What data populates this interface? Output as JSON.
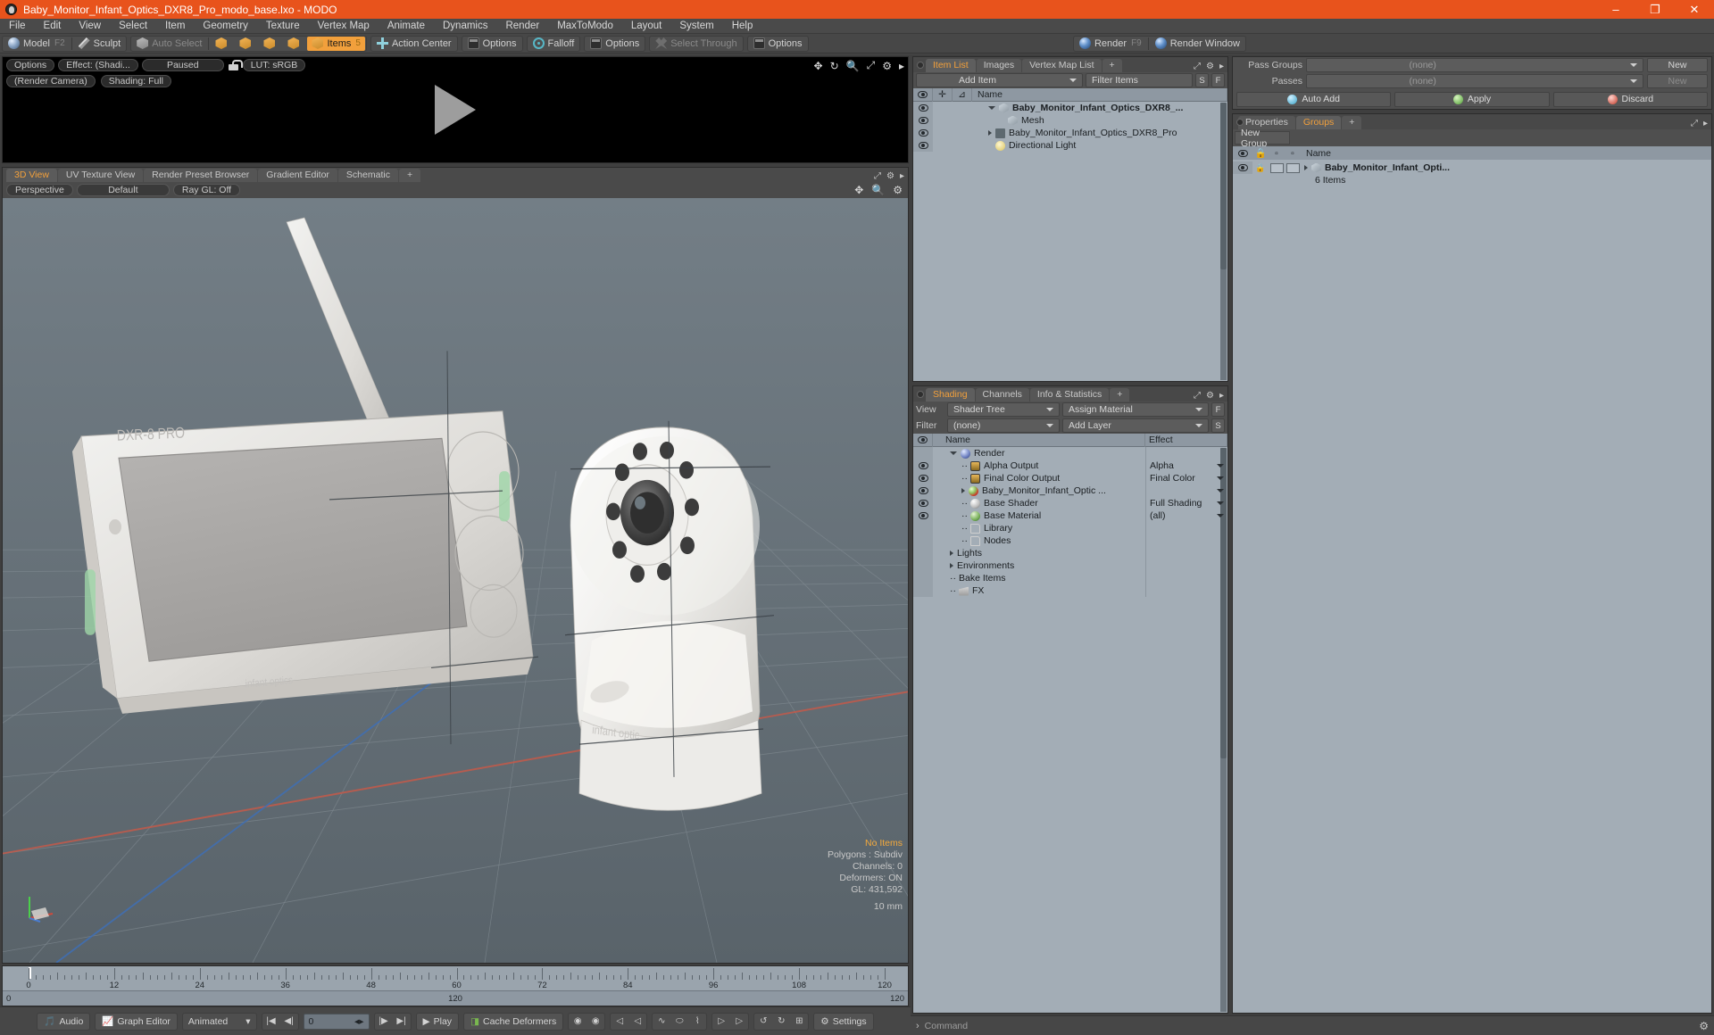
{
  "titlebar": {
    "title": "Baby_Monitor_Infant_Optics_DXR8_Pro_modo_base.lxo - MODO",
    "minimize": "–",
    "maximize": "❐",
    "close": "✕"
  },
  "menubar": {
    "items": [
      "File",
      "Edit",
      "View",
      "Select",
      "Item",
      "Geometry",
      "Texture",
      "Vertex Map",
      "Animate",
      "Dynamics",
      "Render",
      "MaxToModo",
      "Layout",
      "System",
      "Help"
    ]
  },
  "toolbar": {
    "model": "Model",
    "model_key": "F2",
    "sculpt": "Sculpt",
    "auto_select": "Auto Select",
    "items": "Items",
    "items_key": "5",
    "action_center": "Action Center",
    "options1": "Options",
    "falloff": "Falloff",
    "options2": "Options",
    "select_through": "Select Through",
    "options3": "Options",
    "render": "Render",
    "render_key": "F9",
    "render_window": "Render Window"
  },
  "preview": {
    "options": "Options",
    "effect": "Effect: (Shadi...",
    "paused": "Paused",
    "lut": "LUT: sRGB",
    "render_camera": "(Render Camera)",
    "shading": "Shading: Full"
  },
  "viewport": {
    "tabs": [
      "3D View",
      "UV Texture View",
      "Render Preset Browser",
      "Gradient Editor",
      "Schematic",
      "+"
    ],
    "active_tab": "3D View",
    "perspective": "Perspective",
    "default": "Default",
    "raygl": "Ray GL: Off",
    "overlay": {
      "no_items": "No Items",
      "polygons": "Polygons : Subdiv",
      "channels": "Channels: 0",
      "deformers": "Deformers: ON",
      "gl": "GL: 431,592",
      "scale": "10 mm"
    },
    "model_label_screen": "DXR-8 PRO",
    "model_label_brand": "infant optics"
  },
  "timeline": {
    "ticks": [
      "0",
      "12",
      "24",
      "36",
      "48",
      "60",
      "72",
      "84",
      "96",
      "108",
      "120"
    ],
    "range_start": "0",
    "range_mid": "120",
    "range_end": "120"
  },
  "bottombar": {
    "audio": "Audio",
    "graph_editor": "Graph Editor",
    "animated": "Animated",
    "frame": "0",
    "play": "Play",
    "cache_deformers": "Cache Deformers",
    "settings": "Settings"
  },
  "item_list": {
    "tabs": [
      "Item List",
      "Images",
      "Vertex Map List",
      "+"
    ],
    "active_tab": "Item List",
    "add_item": "Add Item",
    "filter_items": "Filter Items",
    "btn_s": "S",
    "btn_f": "F",
    "col_name": "Name",
    "rows": [
      {
        "name": "Baby_Monitor_Infant_Optics_DXR8_...",
        "icon": "mesh-group-icon",
        "indent": 1,
        "twist": "open",
        "bold": true
      },
      {
        "name": "Mesh",
        "icon": "mesh-icon",
        "indent": 2,
        "twist": "none",
        "bold": false
      },
      {
        "name": "Baby_Monitor_Infant_Optics_DXR8_Pro",
        "icon": "camera-icon",
        "indent": 1,
        "twist": "closed",
        "bold": false
      },
      {
        "name": "Directional Light",
        "icon": "light-icon",
        "indent": 1,
        "twist": "none",
        "bold": false
      }
    ]
  },
  "shading": {
    "tabs": [
      "Shading",
      "Channels",
      "Info & Statistics",
      "+"
    ],
    "active_tab": "Shading",
    "view_label": "View",
    "view_value": "Shader Tree",
    "assign_material": "Assign Material",
    "btn_f": "F",
    "filter_label": "Filter",
    "filter_value": "(none)",
    "add_layer": "Add Layer",
    "btn_s": "S",
    "col_name": "Name",
    "col_effect": "Effect",
    "rows": [
      {
        "name": "Render",
        "effect": "",
        "icon": "sphere-blue-icon",
        "indent": 1,
        "twist": "open",
        "eye": false,
        "dropdown": false
      },
      {
        "name": "Alpha Output",
        "effect": "Alpha",
        "icon": "image-icon",
        "indent": 2,
        "twist": "none",
        "eye": true,
        "dropdown": true
      },
      {
        "name": "Final Color Output",
        "effect": "Final Color",
        "icon": "image-icon",
        "indent": 2,
        "twist": "none",
        "eye": true,
        "dropdown": true
      },
      {
        "name": "Baby_Monitor_Infant_Optic ...",
        "effect": "",
        "icon": "sphere-red-icon",
        "indent": 2,
        "twist": "closed",
        "eye": true,
        "dropdown": true
      },
      {
        "name": "Base Shader",
        "effect": "Full Shading",
        "icon": "sphere-white-icon",
        "indent": 2,
        "twist": "none",
        "eye": true,
        "dropdown": true
      },
      {
        "name": "Base Material",
        "effect": "(all)",
        "icon": "sphere-green-icon",
        "indent": 2,
        "twist": "none",
        "eye": true,
        "dropdown": true
      },
      {
        "name": "Library",
        "effect": "",
        "icon": "folder-icon",
        "indent": 2,
        "twist": "none",
        "eye": false,
        "dropdown": false
      },
      {
        "name": "Nodes",
        "effect": "",
        "icon": "folder-icon",
        "indent": 2,
        "twist": "none",
        "eye": false,
        "dropdown": false
      },
      {
        "name": "Lights",
        "effect": "",
        "icon": "none",
        "indent": 1,
        "twist": "closed",
        "eye": false,
        "dropdown": false
      },
      {
        "name": "Environments",
        "effect": "",
        "icon": "none",
        "indent": 1,
        "twist": "closed",
        "eye": false,
        "dropdown": false
      },
      {
        "name": "Bake Items",
        "effect": "",
        "icon": "none",
        "indent": 1,
        "twist": "none",
        "eye": false,
        "dropdown": false
      },
      {
        "name": "FX",
        "effect": "",
        "icon": "fx-icon",
        "indent": 1,
        "twist": "none",
        "eye": false,
        "dropdown": false
      }
    ]
  },
  "passes": {
    "pass_groups_label": "Pass Groups",
    "pass_groups_value": "(none)",
    "pass_groups_new": "New",
    "passes_label": "Passes",
    "passes_value": "(none)",
    "passes_new": "New",
    "auto_add": "Auto Add",
    "apply": "Apply",
    "discard": "Discard"
  },
  "groups": {
    "tabs": [
      "Properties",
      "Groups",
      "+"
    ],
    "active_tab": "Groups",
    "new_group": "New Group",
    "col_name": "Name",
    "item_name": "Baby_Monitor_Infant_Opti...",
    "item_count": "6 Items"
  },
  "command": {
    "placeholder": "Command",
    "prompt": "›"
  },
  "colors": {
    "title_bar": "#e8531c",
    "accent_orange": "#f2a03c",
    "panel_bg": "#4f4f4f",
    "tree_bg": "#a3adb6",
    "viewport_bg": "#68737b"
  }
}
